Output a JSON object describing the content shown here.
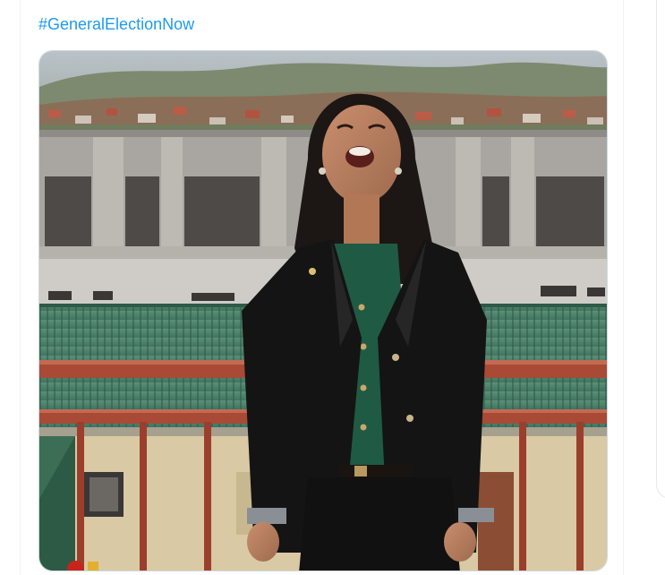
{
  "tweet": {
    "hashtag": "#GeneralElectionNow",
    "photo_label": "photo"
  },
  "colors": {
    "link": "#1d9bf0",
    "border": "#cfd9de"
  }
}
